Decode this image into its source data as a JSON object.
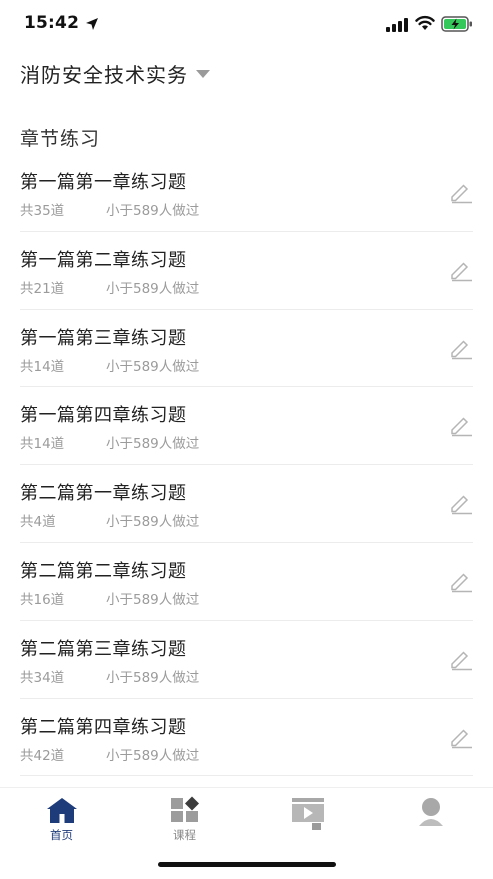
{
  "status_bar": {
    "time": "15:42"
  },
  "header": {
    "subject": "消防安全技术实务"
  },
  "section": {
    "title": "章节练习"
  },
  "items": [
    {
      "title": "第一篇第一章练习题",
      "count": "共35道",
      "done": "小于589人做过"
    },
    {
      "title": "第一篇第二章练习题",
      "count": "共21道",
      "done": "小于589人做过"
    },
    {
      "title": "第一篇第三章练习题",
      "count": "共14道",
      "done": "小于589人做过"
    },
    {
      "title": "第一篇第四章练习题",
      "count": "共14道",
      "done": "小于589人做过"
    },
    {
      "title": "第二篇第一章练习题",
      "count": "共4道",
      "done": "小于589人做过"
    },
    {
      "title": "第二篇第二章练习题",
      "count": "共16道",
      "done": "小于589人做过"
    },
    {
      "title": "第二篇第三章练习题",
      "count": "共34道",
      "done": "小于589人做过"
    },
    {
      "title": "第二篇第四章练习题",
      "count": "共42道",
      "done": "小于589人做过"
    }
  ],
  "tab_bar": {
    "tabs": [
      {
        "label": "首页",
        "icon": "home-icon",
        "active": true
      },
      {
        "label": "课程",
        "icon": "course-icon",
        "active": false
      },
      {
        "label": "",
        "icon": "video-icon",
        "active": false
      },
      {
        "label": "",
        "icon": "profile-icon",
        "active": false
      }
    ]
  },
  "colors": {
    "accent": "#1e3c7a",
    "muted_text": "#9b9b9b",
    "battery_green": "#34c759"
  }
}
